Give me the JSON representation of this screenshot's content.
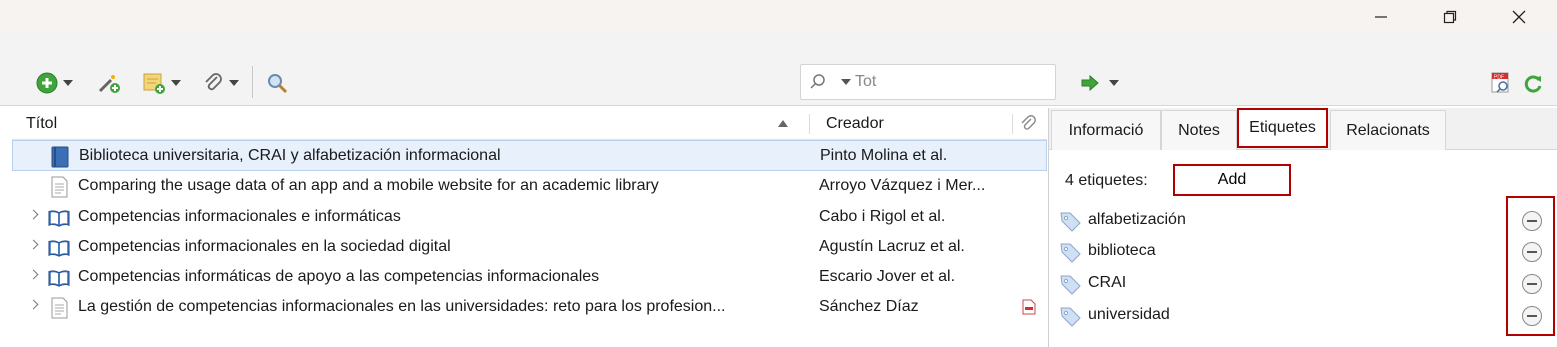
{
  "toolbar": {
    "search_placeholder": "Tot"
  },
  "items": {
    "columns": {
      "title": "Títol",
      "creator": "Creador"
    },
    "rows": [
      {
        "title": "Biblioteca universitaria, CRAI y alfabetización informacional",
        "creator": "Pinto Molina et al.",
        "icon": "book-icon",
        "selected": true
      },
      {
        "title": "Comparing the usage data of an app and a mobile website for an academic library",
        "creator": "Arroyo Vázquez i Mer...",
        "icon": "journal-article-icon"
      },
      {
        "title": "Competencias informacionales e informáticas",
        "creator": "Cabo i Rigol et al.",
        "icon": "open-book-icon"
      },
      {
        "title": "Competencias informacionales en la sociedad digital",
        "creator": "Agustín Lacruz et al.",
        "icon": "open-book-icon"
      },
      {
        "title": "Competencias informáticas de apoyo a las competencias informacionales",
        "creator": "Escario Jover et al.",
        "icon": "open-book-icon"
      },
      {
        "title": "La gestión de competencias informacionales en las universidades: reto para los profesion...",
        "creator": "Sánchez Díaz",
        "icon": "journal-article-icon",
        "attachment": "pdf-icon"
      }
    ]
  },
  "tabs": [
    "Informació",
    "Notes",
    "Etiquetes",
    "Relacionats"
  ],
  "tags_panel": {
    "count_label": "4 etiquetes:",
    "add_label": "Add",
    "tags": [
      "alfabetización",
      "biblioteca",
      "CRAI",
      "universidad"
    ]
  },
  "colors": {
    "highlight_frame": "#b00000",
    "selection": "#e8f0fb"
  }
}
